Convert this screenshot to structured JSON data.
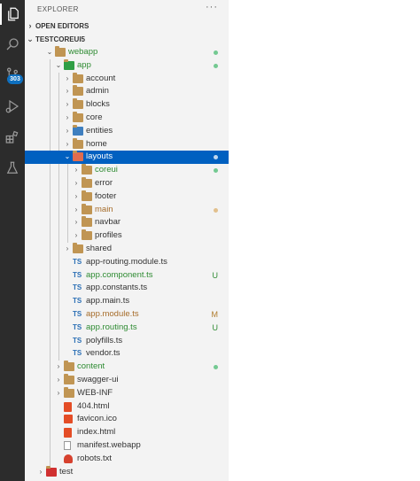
{
  "colors": {
    "activity_bg": "#2c2c2c",
    "sidebar_bg": "#f3f3f3",
    "selection": "#0060c0",
    "git_green": "#73c991",
    "git_orange": "#e2c08d"
  },
  "activity": {
    "badge": "303"
  },
  "explorer": {
    "title": "EXPLORER",
    "more": "···",
    "open_editors": "OPEN EDITORS",
    "project": "TESTCOREUI5"
  },
  "tree": [
    {
      "label": "webapp",
      "depth": 0,
      "expanded": true,
      "icon": "folder-open-icon",
      "status": "dot",
      "color": "green"
    },
    {
      "label": "app",
      "depth": 1,
      "expanded": true,
      "icon": "app-folder-icon",
      "status": "dot",
      "color": "green"
    },
    {
      "label": "account",
      "depth": 2,
      "expanded": false,
      "icon": "folder-icon"
    },
    {
      "label": "admin",
      "depth": 2,
      "expanded": false,
      "icon": "folder-icon"
    },
    {
      "label": "blocks",
      "depth": 2,
      "expanded": false,
      "icon": "folder-icon"
    },
    {
      "label": "core",
      "depth": 2,
      "expanded": false,
      "icon": "folder-icon"
    },
    {
      "label": "entities",
      "depth": 2,
      "expanded": false,
      "icon": "entities-folder-icon"
    },
    {
      "label": "home",
      "depth": 2,
      "expanded": false,
      "icon": "folder-icon"
    },
    {
      "label": "layouts",
      "depth": 2,
      "expanded": true,
      "icon": "layout-folder-icon",
      "status": "dot",
      "selected": true
    },
    {
      "label": "coreui",
      "depth": 3,
      "expanded": false,
      "icon": "folder-icon",
      "status": "dot",
      "color": "green"
    },
    {
      "label": "error",
      "depth": 3,
      "expanded": false,
      "icon": "folder-icon"
    },
    {
      "label": "footer",
      "depth": 3,
      "expanded": false,
      "icon": "folder-icon"
    },
    {
      "label": "main",
      "depth": 3,
      "expanded": false,
      "icon": "folder-icon",
      "status": "dot",
      "color": "orange"
    },
    {
      "label": "navbar",
      "depth": 3,
      "expanded": false,
      "icon": "folder-icon"
    },
    {
      "label": "profiles",
      "depth": 3,
      "expanded": false,
      "icon": "folder-icon"
    },
    {
      "label": "shared",
      "depth": 2,
      "expanded": false,
      "icon": "folder-icon"
    },
    {
      "label": "app-routing.module.ts",
      "depth": 2,
      "file": true,
      "icon": "typescript-icon"
    },
    {
      "label": "app.component.ts",
      "depth": 2,
      "file": true,
      "icon": "typescript-icon",
      "status": "U",
      "color": "green"
    },
    {
      "label": "app.constants.ts",
      "depth": 2,
      "file": true,
      "icon": "typescript-icon"
    },
    {
      "label": "app.main.ts",
      "depth": 2,
      "file": true,
      "icon": "typescript-icon"
    },
    {
      "label": "app.module.ts",
      "depth": 2,
      "file": true,
      "icon": "typescript-icon",
      "status": "M",
      "color": "orange"
    },
    {
      "label": "app.routing.ts",
      "depth": 2,
      "file": true,
      "icon": "typescript-icon",
      "status": "U",
      "color": "green"
    },
    {
      "label": "polyfills.ts",
      "depth": 2,
      "file": true,
      "icon": "typescript-icon"
    },
    {
      "label": "vendor.ts",
      "depth": 2,
      "file": true,
      "icon": "typescript-icon"
    },
    {
      "label": "content",
      "depth": 1,
      "expanded": false,
      "icon": "folder-icon",
      "status": "dot",
      "color": "green"
    },
    {
      "label": "swagger-ui",
      "depth": 1,
      "expanded": false,
      "icon": "folder-icon"
    },
    {
      "label": "WEB-INF",
      "depth": 1,
      "expanded": false,
      "icon": "folder-icon"
    },
    {
      "label": "404.html",
      "depth": 1,
      "file": true,
      "icon": "html5-icon"
    },
    {
      "label": "favicon.ico",
      "depth": 1,
      "file": true,
      "icon": "favicon-icon"
    },
    {
      "label": "index.html",
      "depth": 1,
      "file": true,
      "icon": "html5-icon"
    },
    {
      "label": "manifest.webapp",
      "depth": 1,
      "file": true,
      "icon": "file-icon"
    },
    {
      "label": "robots.txt",
      "depth": 1,
      "file": true,
      "icon": "robot-icon"
    },
    {
      "label": "test",
      "depth": -1,
      "expanded": false,
      "icon": "test-folder-icon"
    }
  ]
}
